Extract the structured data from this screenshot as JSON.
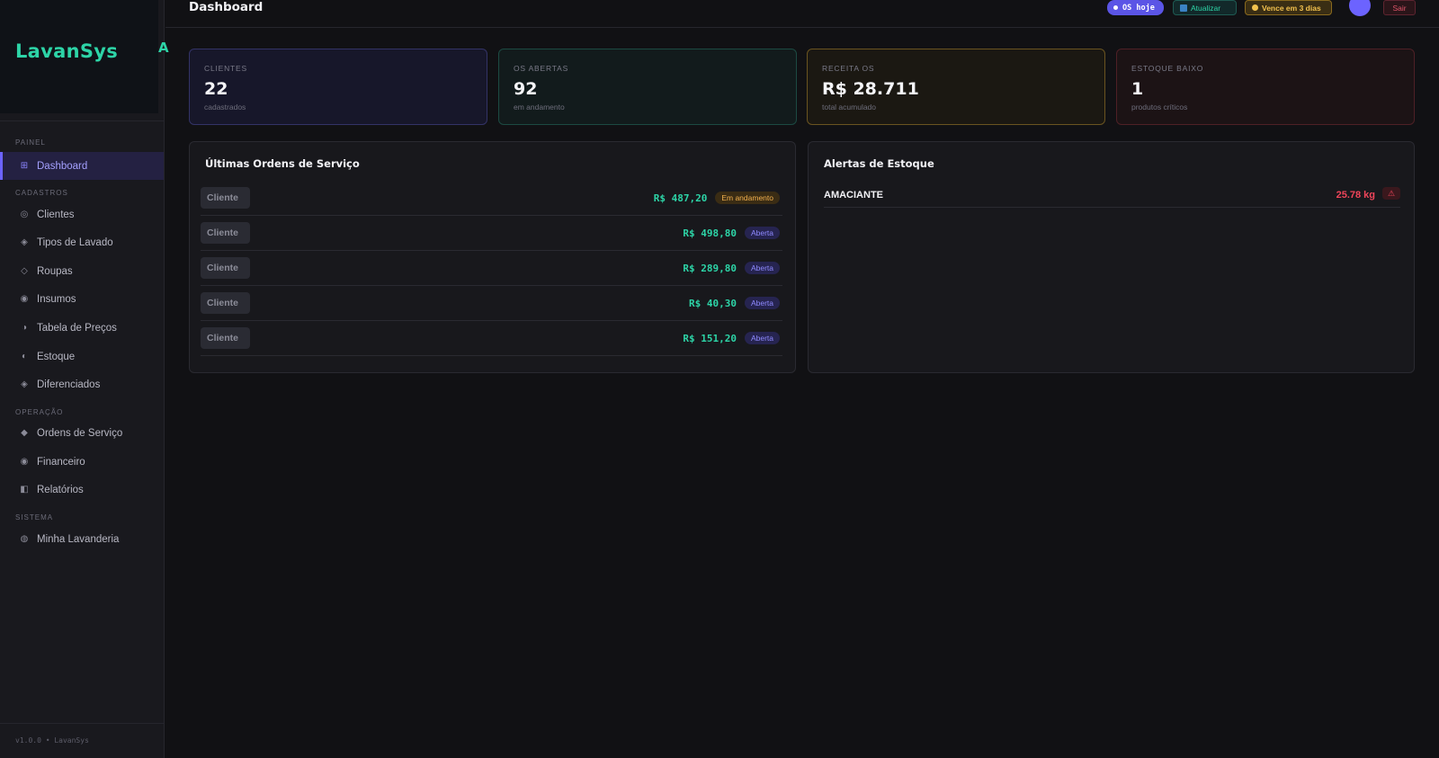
{
  "app": {
    "name": "LavanSys",
    "mark": "A",
    "version": "v1.0.0 • LavanSys"
  },
  "sidebar": {
    "sections": [
      {
        "label": "PAINEL"
      },
      {
        "label": "CADASTROS"
      },
      {
        "label": "OPERAÇÃO"
      },
      {
        "label": "SISTEMA"
      }
    ],
    "items": [
      {
        "label": "Dashboard",
        "icon": "⊞",
        "icon_name": "grid-icon",
        "active": true
      },
      {
        "label": "Clientes",
        "icon": "◎",
        "icon_name": "users-icon"
      },
      {
        "label": "Tipos de Lavado",
        "icon": "◈",
        "icon_name": "diamond-icon"
      },
      {
        "label": "Roupas",
        "icon": "◇",
        "icon_name": "diamond-outline-icon"
      },
      {
        "label": "Insumos",
        "icon": "◉",
        "icon_name": "circle-dot-icon"
      },
      {
        "label": "Tabela de Preços",
        "icon": "◑",
        "icon_name": "half-circle-icon"
      },
      {
        "label": "Estoque",
        "icon": "◐",
        "icon_name": "half-circle-left-icon"
      },
      {
        "label": "Diferenciados",
        "icon": "◈",
        "icon_name": "diamond-icon"
      },
      {
        "label": "Ordens de Serviço",
        "icon": "◆",
        "icon_name": "diamond-filled-icon"
      },
      {
        "label": "Financeiro",
        "icon": "◉",
        "icon_name": "circle-dot-icon"
      },
      {
        "label": "Relatórios",
        "icon": "◧",
        "icon_name": "square-half-icon"
      },
      {
        "label": "Minha Lavanderia",
        "icon": "◍",
        "icon_name": "circle-hatched-icon"
      }
    ]
  },
  "topbar": {
    "title": "Dashboard",
    "os_today": "OS hoje",
    "refresh": "Atualizar",
    "due": "Vence em 3 dias",
    "logout": "Sair"
  },
  "stats": [
    {
      "label": "CLIENTES",
      "value": "22",
      "sub": "cadastrados"
    },
    {
      "label": "OS ABERTAS",
      "value": "92",
      "sub": "em andamento"
    },
    {
      "label": "RECEITA OS",
      "value": "R$ 28.711",
      "sub": "total acumulado"
    },
    {
      "label": "ESTOQUE BAIXO",
      "value": "1",
      "sub": "produtos críticos"
    }
  ],
  "orders": {
    "title": "Últimas Ordens de Serviço",
    "rows": [
      {
        "client": "Cliente",
        "amount": "R$ 487,20",
        "status": "Em andamento"
      },
      {
        "client": "Cliente",
        "amount": "R$ 498,80",
        "status": "Aberta"
      },
      {
        "client": "Cliente",
        "amount": "R$ 289,80",
        "status": "Aberta"
      },
      {
        "client": "Cliente",
        "amount": "R$ 40,30",
        "status": "Aberta"
      },
      {
        "client": "Cliente",
        "amount": "R$ 151,20",
        "status": "Aberta"
      }
    ]
  },
  "alerts": {
    "title": "Alertas de Estoque",
    "rows": [
      {
        "name": "AMACIANTE",
        "qty": "25.78 kg",
        "icon": "⚠"
      }
    ]
  },
  "colors": {
    "accent": "#6c63ff",
    "brand": "#2dd4a7",
    "danger": "#f0455a",
    "warning": "#f2b04e"
  }
}
